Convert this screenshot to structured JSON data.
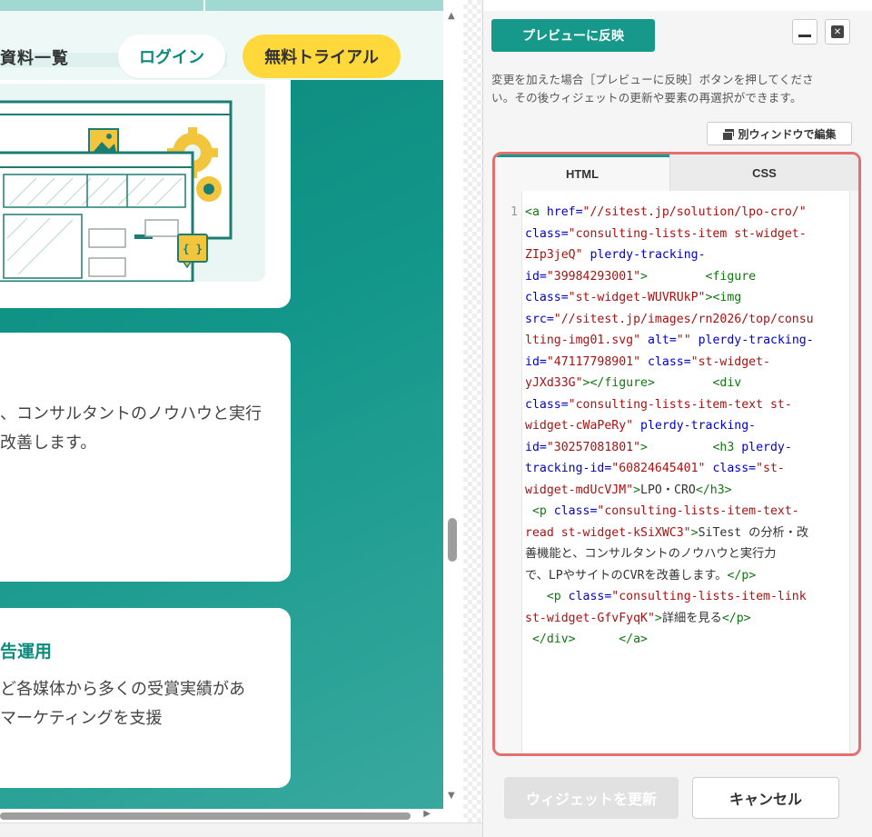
{
  "preview": {
    "nav_docs": "資料一覧",
    "login_label": "ログイン",
    "trial_label": "無料トライアル",
    "card2": {
      "line1": "、コンサルタントのノウハウと実行",
      "line2": "改善します。"
    },
    "card3": {
      "heading": "告運用",
      "line1": "ど各媒体から多くの受賞実績があ",
      "line2": "マーケティングを支援"
    },
    "illustration_code_badge": "{ }"
  },
  "panel": {
    "apply_button": "プレビューに反映",
    "minimize_icon": "minimize-icon",
    "close_icon": "close-icon",
    "hint_line1": "変更を加えた場合［プレビューに反映］ボタンを押してくださ",
    "hint_line2": "い。その後ウィジェットの更新や要素の再選択ができます。",
    "separate_window_button": "別ウィンドウで編集",
    "tabs": [
      "HTML",
      "CSS"
    ],
    "active_tab": "HTML",
    "line_number": "1",
    "update_button": "ウィジェットを更新",
    "cancel_button": "キャンセル"
  },
  "code_lines": [
    [
      [
        "tag",
        "<a "
      ],
      [
        "attr",
        "href="
      ],
      [
        "str",
        "\"//sitest.jp/solution/lpo-cro/\""
      ]
    ],
    [
      [
        "attr",
        "class="
      ],
      [
        "str",
        "\"consulting-lists-item st-widget-"
      ]
    ],
    [
      [
        "str",
        "ZIp3jeQ\""
      ],
      [
        "txt",
        " "
      ],
      [
        "attr",
        "plerdy-tracking-"
      ]
    ],
    [
      [
        "attr",
        "id="
      ],
      [
        "str",
        "\"39984293001\""
      ],
      [
        "tag",
        ">"
      ],
      [
        "txt",
        "        "
      ],
      [
        "tag",
        "<figure"
      ]
    ],
    [
      [
        "attr",
        "class="
      ],
      [
        "str",
        "\"st-widget-WUVRUkP\""
      ],
      [
        "tag",
        ">"
      ],
      [
        "tag",
        "<img"
      ]
    ],
    [
      [
        "attr",
        "src="
      ],
      [
        "str",
        "\"//sitest.jp/images/rn2026/top/consu"
      ]
    ],
    [
      [
        "str",
        "lting-img01.svg\""
      ],
      [
        "txt",
        " "
      ],
      [
        "attr",
        "alt="
      ],
      [
        "str",
        "\"\""
      ],
      [
        "txt",
        " "
      ],
      [
        "attr",
        "plerdy-tracking-"
      ]
    ],
    [
      [
        "attr",
        "id="
      ],
      [
        "str",
        "\"47117798901\""
      ],
      [
        "txt",
        " "
      ],
      [
        "attr",
        "class="
      ],
      [
        "str",
        "\"st-widget-"
      ]
    ],
    [
      [
        "str",
        "yJXd33G\""
      ],
      [
        "tag",
        "></figure>"
      ],
      [
        "txt",
        "        "
      ],
      [
        "tag",
        "<div"
      ]
    ],
    [
      [
        "attr",
        "class="
      ],
      [
        "str",
        "\"consulting-lists-item-text st-"
      ]
    ],
    [
      [
        "str",
        "widget-cWaPeRy\""
      ],
      [
        "txt",
        " "
      ],
      [
        "attr",
        "plerdy-tracking-"
      ]
    ],
    [
      [
        "attr",
        "id="
      ],
      [
        "str",
        "\"30257081801\""
      ],
      [
        "tag",
        ">"
      ],
      [
        "txt",
        "         "
      ],
      [
        "tag",
        "<h3 "
      ],
      [
        "attr",
        "plerdy-"
      ]
    ],
    [
      [
        "attr",
        "tracking-id="
      ],
      [
        "str",
        "\"60824645401\""
      ],
      [
        "txt",
        " "
      ],
      [
        "attr",
        "class="
      ],
      [
        "str",
        "\"st-"
      ]
    ],
    [
      [
        "str",
        "widget-mdUcVJM\""
      ],
      [
        "tag",
        ">"
      ],
      [
        "txt",
        "LPO・CRO"
      ],
      [
        "tag",
        "</h3>"
      ]
    ],
    [
      [
        "txt",
        " "
      ],
      [
        "tag",
        "<p "
      ],
      [
        "attr",
        "class="
      ],
      [
        "str",
        "\"consulting-lists-item-text-"
      ]
    ],
    [
      [
        "str",
        "read st-widget-kSiXWC3\""
      ],
      [
        "tag",
        ">"
      ],
      [
        "txt",
        "SiTest の分析・改"
      ]
    ],
    [
      [
        "txt",
        "善機能と、コンサルタントのノウハウと実行力"
      ]
    ],
    [
      [
        "txt",
        "で、LPやサイトのCVRを改善します。"
      ],
      [
        "tag",
        "</p>"
      ]
    ],
    [
      [
        "txt",
        "   "
      ],
      [
        "tag",
        "<p "
      ],
      [
        "attr",
        "class="
      ],
      [
        "str",
        "\"consulting-lists-item-link"
      ]
    ],
    [
      [
        "str",
        "st-widget-GfvFyqK\""
      ],
      [
        "tag",
        ">"
      ],
      [
        "txt",
        "詳細を見る"
      ],
      [
        "tag",
        "</p>"
      ]
    ],
    [
      [
        "txt",
        " "
      ],
      [
        "tag",
        "</div>"
      ],
      [
        "txt",
        "      "
      ],
      [
        "tag",
        "</a>"
      ]
    ]
  ]
}
